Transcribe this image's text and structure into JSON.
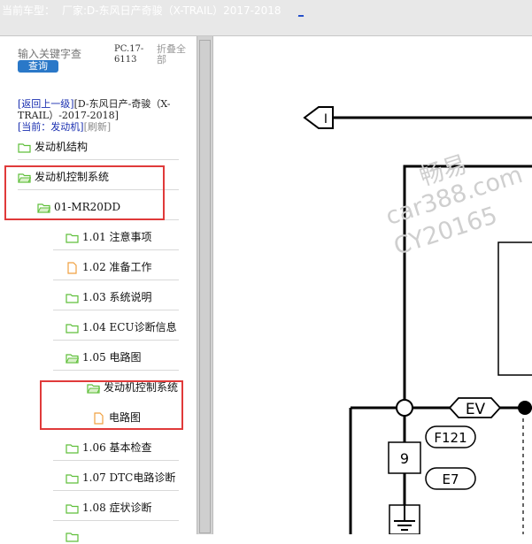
{
  "header": {
    "label": "当前车型：",
    "vehicle": "厂家:D-东风日产奇骏（X-TRAIL）2017-2018",
    "underscore": "_"
  },
  "search": {
    "placeholder": "输入关键字查",
    "button": "查询",
    "pc_code": "PC.17-6113",
    "collapse_all": "折叠全部"
  },
  "nav": {
    "back": "[返回上一级]",
    "path": "[D-东风日产-奇骏（X-TRAIL）-2017-2018]",
    "current_label": "[当前：发动机]",
    "refresh": "[刷新]"
  },
  "tree": {
    "engine_structure": "发动机结构",
    "engine_control": "发动机控制系统",
    "mr20dd": "01-MR20DD",
    "i101": "1.01 注意事项",
    "i102": "1.02 准备工作",
    "i103": "1.03 系统说明",
    "i104": "1.04 ECU诊断信息",
    "i105": "1.05 电路图",
    "sub_engine_control": "发动机控制系统",
    "sub_circuit": "电路图",
    "i106": "1.06 基本检查",
    "i107": "1.07 DTC电路诊断",
    "i108": "1.08 症状诊断"
  },
  "diagram": {
    "arrow_label": "I",
    "ev_label": "EV",
    "f121_label": "F121",
    "e7_label": "E7",
    "pin_label": "9"
  },
  "watermark": {
    "line1": "畅易",
    "line2": "car388.com",
    "line3": "CY20165"
  },
  "colors": {
    "highlight": "#e03a3a",
    "link": "#1a2fb0",
    "button": "#2a78c8",
    "folder_green": "#5fbf3a",
    "file_orange": "#f0a040"
  }
}
